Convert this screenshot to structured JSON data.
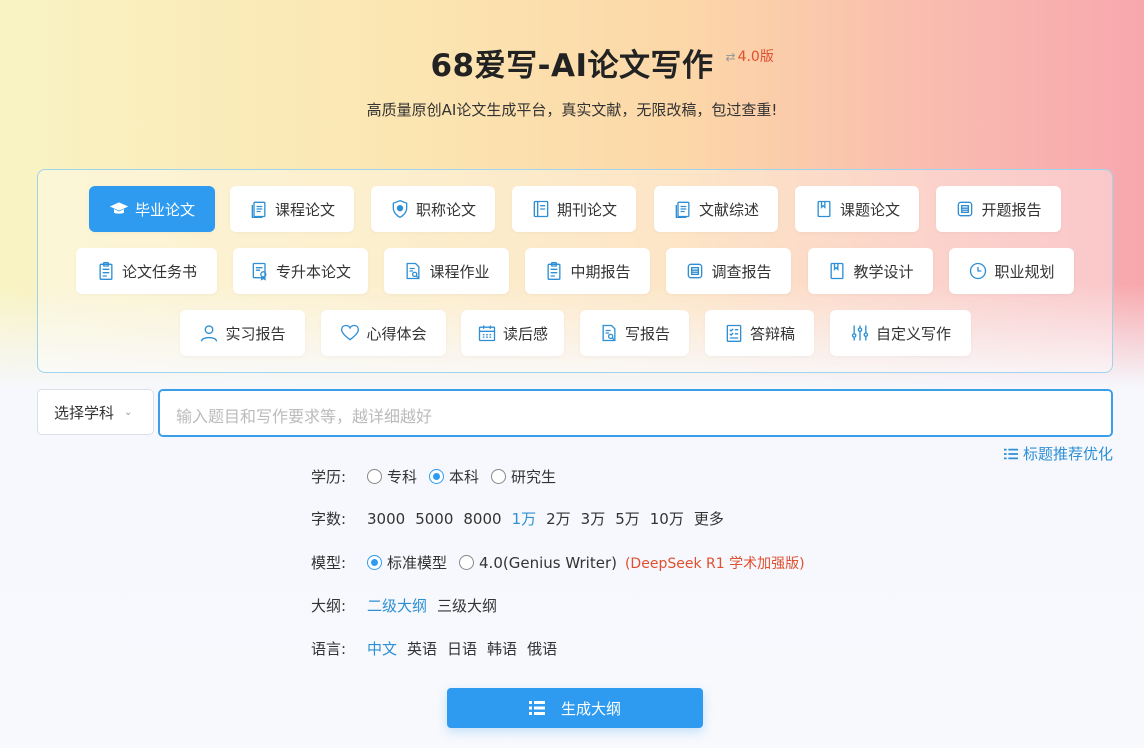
{
  "header": {
    "title": "68爱写-AI论文写作",
    "version": "4.0版",
    "subtitle": "高质量原创AI论文生成平台，真实文献，无限改稿，包过查重!"
  },
  "paper_types": [
    {
      "label": "毕业论文",
      "icon": "graduation-cap-icon",
      "active": true
    },
    {
      "label": "课程论文",
      "icon": "document-copy-icon"
    },
    {
      "label": "职称论文",
      "icon": "shield-badge-icon"
    },
    {
      "label": "期刊论文",
      "icon": "journal-icon"
    },
    {
      "label": "文献综述",
      "icon": "document-copy-icon"
    },
    {
      "label": "课题论文",
      "icon": "book-icon"
    },
    {
      "label": "开题报告",
      "icon": "report-icon"
    },
    {
      "label": "论文任务书",
      "icon": "clipboard-icon"
    },
    {
      "label": "专升本论文",
      "icon": "certificate-icon"
    },
    {
      "label": "课程作业",
      "icon": "document-search-icon"
    },
    {
      "label": "中期报告",
      "icon": "clipboard-icon"
    },
    {
      "label": "调查报告",
      "icon": "report-icon"
    },
    {
      "label": "教学设计",
      "icon": "book-icon"
    },
    {
      "label": "职业规划",
      "icon": "clock-icon"
    },
    {
      "label": "实习报告",
      "icon": "user-icon"
    },
    {
      "label": "心得体会",
      "icon": "heart-icon"
    },
    {
      "label": "读后感",
      "icon": "calendar-icon"
    },
    {
      "label": "写报告",
      "icon": "document-search-icon"
    },
    {
      "label": "答辩稿",
      "icon": "checklist-icon"
    },
    {
      "label": "自定义写作",
      "icon": "sliders-icon"
    }
  ],
  "subject_select": {
    "label": "选择学科"
  },
  "topic_input": {
    "placeholder": "输入题目和写作要求等，越详细越好",
    "value": ""
  },
  "recommend_link": "标题推荐优化",
  "options": {
    "education": {
      "label": "学历:",
      "choices": [
        "专科",
        "本科",
        "研究生"
      ],
      "selected": "本科"
    },
    "word_count": {
      "label": "字数:",
      "choices": [
        "3000",
        "5000",
        "8000",
        "1万",
        "2万",
        "3万",
        "5万",
        "10万",
        "更多"
      ],
      "selected": "1万"
    },
    "model": {
      "label": "模型:",
      "choices": [
        "标准模型",
        "4.0(Genius Writer)"
      ],
      "selected": "标准模型",
      "note": "(DeepSeek R1 学术加强版)"
    },
    "outline": {
      "label": "大纲:",
      "choices": [
        "二级大纲",
        "三级大纲"
      ],
      "selected": "二级大纲"
    },
    "language": {
      "label": "语言:",
      "choices": [
        "中文",
        "英语",
        "日语",
        "韩语",
        "俄语"
      ],
      "selected": "中文"
    }
  },
  "generate_button": "生成大纲",
  "colors": {
    "accent": "#2e9bf0",
    "link": "#2e8fd4",
    "highlight": "#e0502f"
  }
}
